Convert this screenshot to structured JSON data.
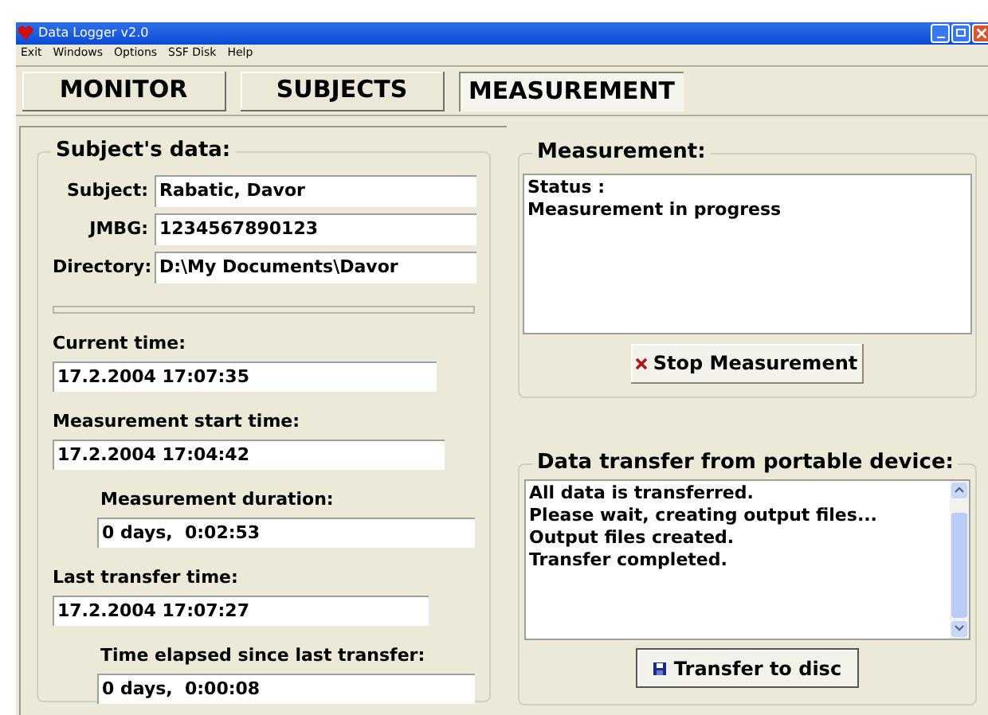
{
  "window": {
    "title": "Data Logger v2.0"
  },
  "menu": [
    "Exit",
    "Windows",
    "Options",
    "SSF Disk",
    "Help"
  ],
  "tabs": [
    {
      "label": "MONITOR",
      "selected": false
    },
    {
      "label": "SUBJECTS",
      "selected": false
    },
    {
      "label": "MEASUREMENT",
      "selected": true
    }
  ],
  "subject_data": {
    "title": "Subject's data:",
    "fields": [
      {
        "label": "Subject:",
        "value": "Rabatic, Davor"
      },
      {
        "label": "JMBG:",
        "value": "1234567890123"
      },
      {
        "label": "Directory:",
        "value": "D:\\My Documents\\Davor"
      }
    ],
    "progress": {
      "level": 0
    },
    "times": [
      {
        "kind": "main",
        "label": "Current time:",
        "value": "17.2.2004 17:07:35"
      },
      {
        "kind": "main",
        "label": "Measurement start time:",
        "value": "17.2.2004 17:04:42"
      },
      {
        "kind": "sub",
        "label": "Measurement duration:",
        "value": "0 days,  0:02:53"
      },
      {
        "kind": "main",
        "label": "Last transfer time:",
        "value": "17.2.2004 17:07:27"
      },
      {
        "kind": "sub",
        "label": "Time elapsed since last transfer:",
        "value": "0 days,  0:00:08"
      }
    ]
  },
  "measurement": {
    "title": "Measurement:",
    "lines": [
      "Status :",
      "Measurement in progress"
    ],
    "button": "Stop Measurement"
  },
  "data_transfer": {
    "title": "Data transfer from portable device:",
    "lines": [
      "All data is transferred.",
      "Please wait, creating output files...",
      "Output files created.",
      "Transfer completed."
    ],
    "button": "Transfer to disc"
  }
}
